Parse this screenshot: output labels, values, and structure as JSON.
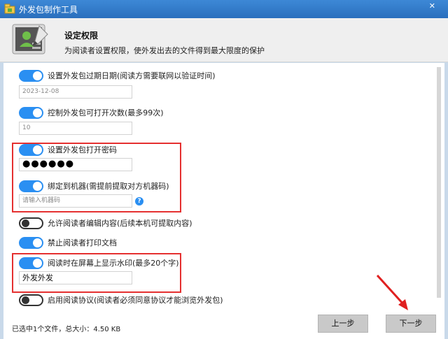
{
  "window": {
    "title": "外发包制作工具",
    "close_glyph": "✕"
  },
  "header": {
    "title": "设定权限",
    "subtitle": "为阅读者设置权限，使外发出去的文件得到最大限度的保护"
  },
  "options": [
    {
      "label": "设置外发包过期日期(阅读方需要联网以验证时间)",
      "on": true
    },
    {
      "label": "控制外发包可打开次数(最多99次)",
      "on": true
    },
    {
      "label": "设置外发包打开密码",
      "on": true
    },
    {
      "label": "绑定到机器(需提前提取对方机器码)",
      "on": true
    },
    {
      "label": "允许阅读者编辑内容(后续本机可提取内容)",
      "on": false
    },
    {
      "label": "禁止阅读者打印文档",
      "on": true
    },
    {
      "label": "阅读时在屏幕上显示水印(最多20个字)",
      "on": true
    },
    {
      "label": "启用阅读协议(阅读者必须同意协议才能浏览外发包)",
      "on": false
    }
  ],
  "fields": {
    "expiry_date": "2023-12-08",
    "open_count": "10",
    "password_mask": "●●●●●●",
    "machine_code_placeholder": "请输入机器码",
    "watermark_text": "外发外发"
  },
  "help_glyph": "?",
  "footer": {
    "status": "已选中1个文件，总大小：4.50 KB",
    "prev_label": "上一步",
    "next_label": "下一步"
  },
  "colors": {
    "accent": "#2a8ff2",
    "highlight": "#e53030",
    "titlebar": "#3d88d6"
  },
  "icons": {
    "app": "package-icon",
    "banner": "user-settings-icon",
    "annotation": "red-arrow-icon"
  }
}
